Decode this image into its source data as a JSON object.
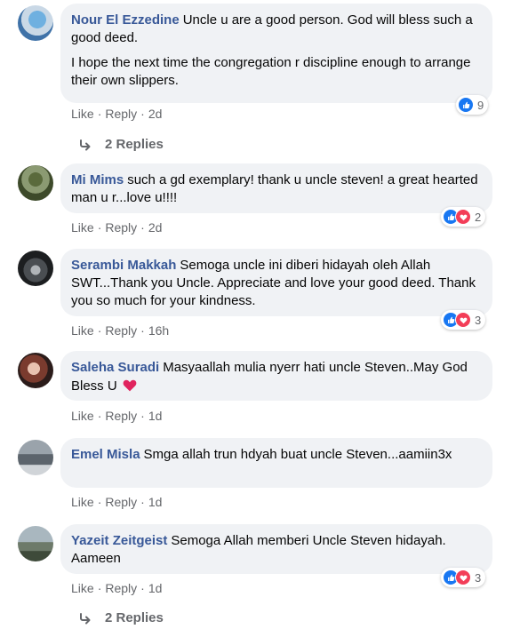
{
  "comments": [
    {
      "author": "Nour El Ezzedine",
      "text": "Uncle u are a good person. God will bless such a good deed.",
      "text2": "I hope the next time the congregation r discipline enough to arrange their own slippers.",
      "like": "Like",
      "reply": "Reply",
      "time": "2d",
      "reactions": {
        "icons": [
          "like-icon"
        ],
        "count": "9"
      },
      "replies_label": "2 Replies"
    },
    {
      "author": "Mi Mims",
      "text": "such a gd exemplary! thank u uncle steven! a great hearted man u r...love u!!!!",
      "like": "Like",
      "reply": "Reply",
      "time": "2d",
      "reactions": {
        "icons": [
          "like-icon",
          "love-icon"
        ],
        "count": "2"
      }
    },
    {
      "author": "Serambi Makkah",
      "text": "Semoga uncle ini diberi hidayah oleh Allah SWT...Thank you Uncle. Appreciate and love your good deed. Thank you so much for your kindness.",
      "like": "Like",
      "reply": "Reply",
      "time": "16h",
      "reactions": {
        "icons": [
          "like-icon",
          "love-icon"
        ],
        "count": "3"
      }
    },
    {
      "author": "Saleha Suradi",
      "text": "Masyaallah mulia nyerr hati uncle Steven..May God Bless U",
      "like": "Like",
      "reply": "Reply",
      "time": "1d"
    },
    {
      "author": "Emel Misla",
      "text": "Smga allah trun hdyah buat uncle Steven...aamiin3x",
      "like": "Like",
      "reply": "Reply",
      "time": "1d"
    },
    {
      "author": "Yazeit Zeitgeist",
      "text": "Semoga Allah memberi Uncle Steven hidayah. Aameen",
      "like": "Like",
      "reply": "Reply",
      "time": "1d",
      "reactions": {
        "icons": [
          "like-icon",
          "love-icon"
        ],
        "count": "3"
      },
      "replies_label": "2 Replies"
    }
  ],
  "colors": {
    "author": "#385898",
    "bubble": "#f0f2f5",
    "muted": "#65676b",
    "like": "#1877f2",
    "love": "#f33e58"
  }
}
